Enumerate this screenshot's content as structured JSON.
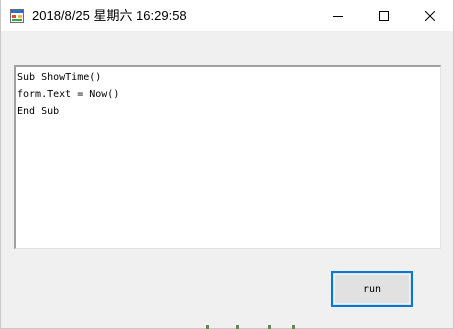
{
  "window": {
    "title": "2018/8/25 星期六 16:29:58",
    "app_icon": "form-app-icon",
    "caption_icons": [
      "minimize-icon",
      "maximize-icon",
      "close-icon"
    ]
  },
  "editor": {
    "value": "Sub ShowTime()\nform.Text = Now()\nEnd Sub"
  },
  "run_button": {
    "label": "run"
  },
  "colors": {
    "focus_border": "#0078d7",
    "button_face": "#e1e1e1",
    "window_background": "#f0f0f0"
  }
}
